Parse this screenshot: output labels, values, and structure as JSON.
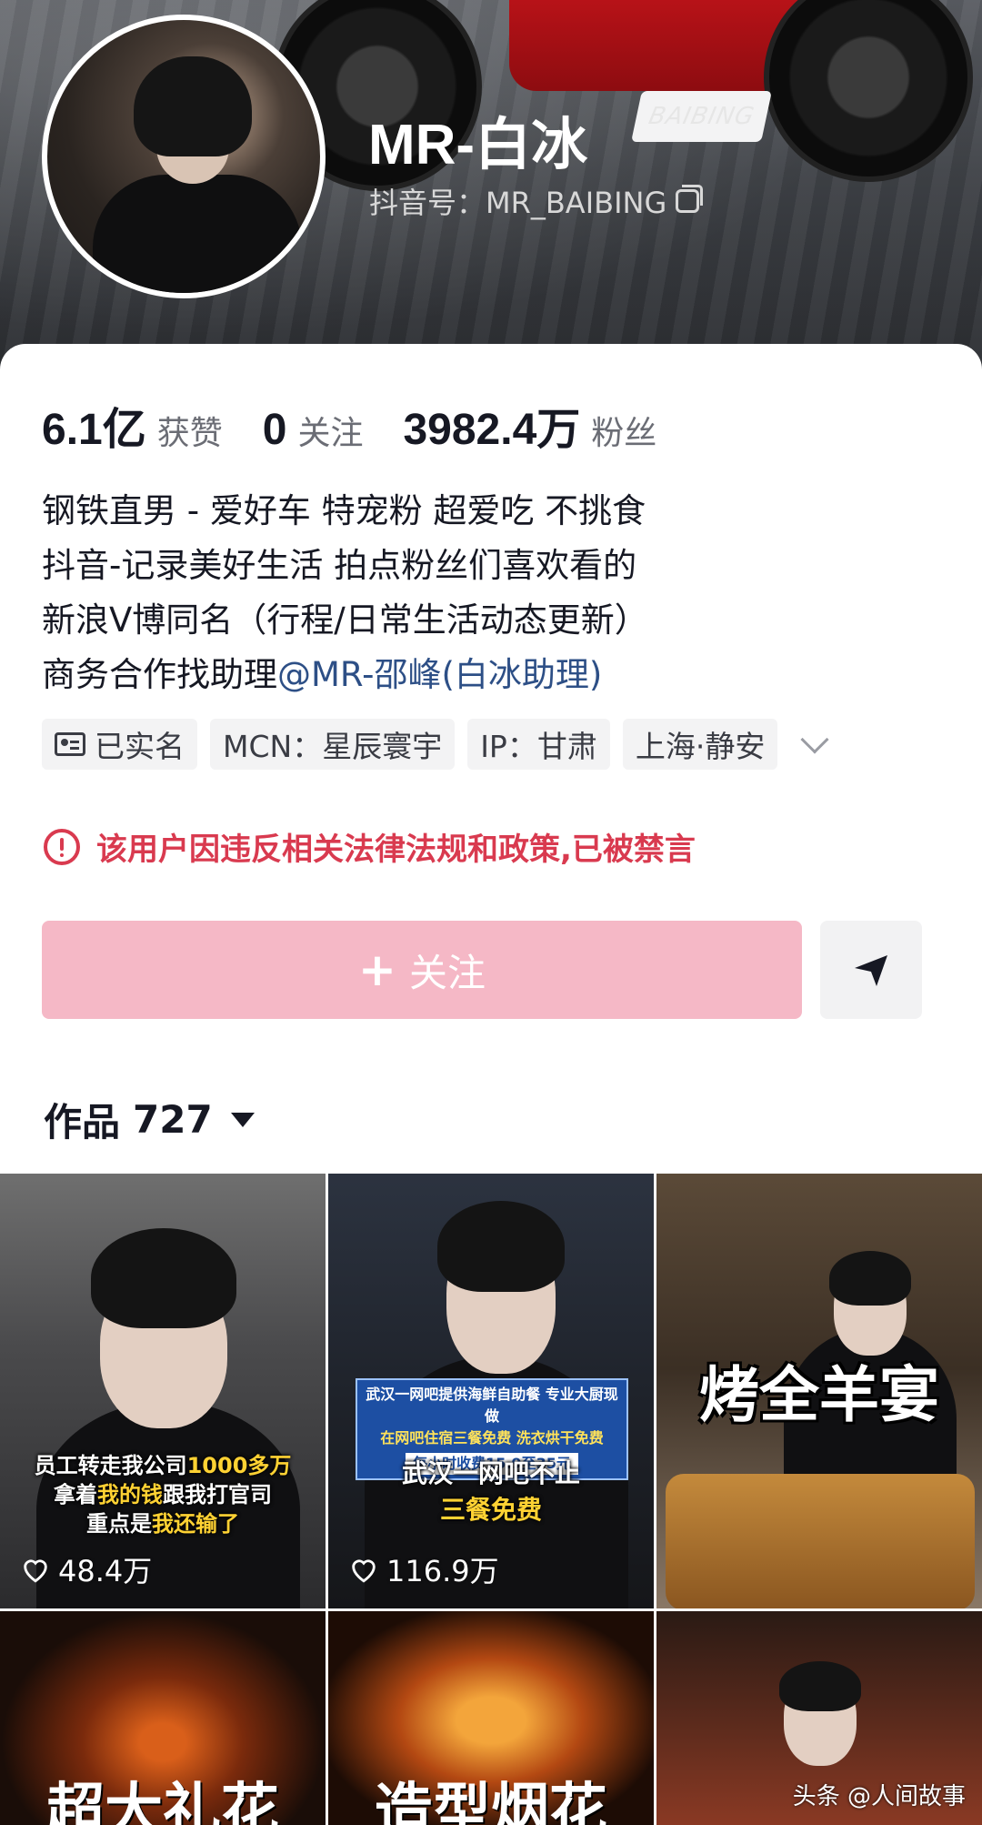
{
  "header": {
    "name": "MR-白冰",
    "douyin_id": "抖音号：MR_BAIBING",
    "banner_tag": "BAIBING"
  },
  "stats": [
    {
      "num": "6.1亿",
      "label": "获赞"
    },
    {
      "num": "0",
      "label": "关注"
    },
    {
      "num": "3982.4万",
      "label": "粉丝"
    }
  ],
  "bio": {
    "line1": "钢铁直男 - 爱好车 特宠粉 超爱吃 不挑食",
    "line2": "抖音-记录美好生活 拍点粉丝们喜欢看的",
    "line3": "新浪V博同名（行程/日常生活动态更新）",
    "line4_prefix": "商务合作找助理",
    "line4_mention": "@MR-邵峰(白冰助理)"
  },
  "tags": {
    "verified": "已实名",
    "mcn": "MCN：星辰寰宇",
    "ip": "IP：甘肃",
    "location": "上海·静安"
  },
  "warning": "该用户因违反相关法律法规和政策,已被禁言",
  "follow_button": "关注",
  "works": {
    "label": "作品",
    "count": "727"
  },
  "videos": [
    {
      "likes": "48.4万",
      "caption_l1a": "员工转走我公司",
      "caption_l1b": "1000多万",
      "caption_l2a": "拿着",
      "caption_l2b": "我的钱",
      "caption_l2c": "跟我打官司",
      "caption_l3a": "重点是",
      "caption_l3b": "我还输了"
    },
    {
      "likes": "116.9万",
      "news_l1a": "武汉一网吧提供海鲜自助餐",
      "news_l1b": "专业大厨现做",
      "news_l2a": "在网吧住宿三餐免费",
      "news_l2b": "洗衣烘干免费",
      "news_price": "每小时收费15.9至35元",
      "caption_l1": "武汉一网吧不止",
      "caption_l2": "三餐免费"
    },
    {
      "title": "烤全羊宴"
    },
    {
      "bottom": "超大礼花"
    },
    {
      "bottom": "造型烟花"
    },
    {
      "watermark": "头条 @人间故事"
    }
  ],
  "colors": {
    "accent_red": "#d93a4f",
    "follow_pink": "#f5b8c6",
    "mention_blue": "#2d4f86"
  }
}
